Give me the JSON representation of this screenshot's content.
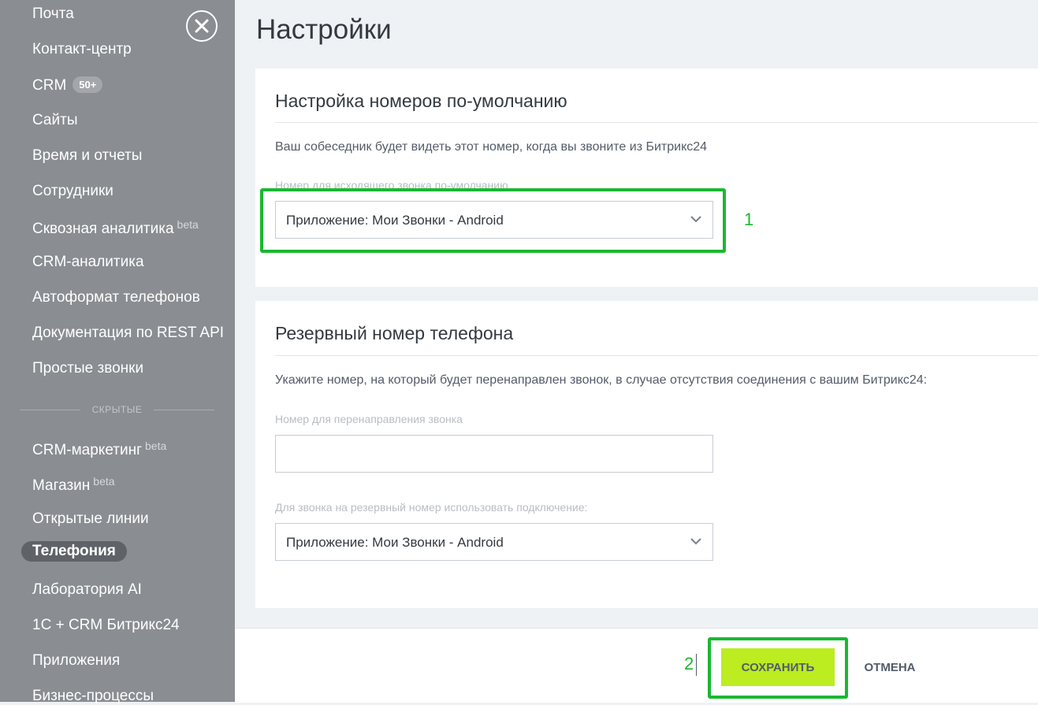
{
  "sidebar": {
    "items": [
      {
        "label": "Почта"
      },
      {
        "label": "Контакт-центр"
      },
      {
        "label": "CRM",
        "badge": "50+"
      },
      {
        "label": "Сайты"
      },
      {
        "label": "Время и отчеты"
      },
      {
        "label": "Сотрудники"
      },
      {
        "label": "Сквозная аналитика",
        "sup": "beta"
      },
      {
        "label": "CRM-аналитика"
      },
      {
        "label": "Автоформат телефонов"
      },
      {
        "label": "Документация по REST API"
      },
      {
        "label": "Простые звонки"
      }
    ],
    "hidden_label": "СКРЫТЫЕ",
    "hidden_items": [
      {
        "label": "CRM-маркетинг",
        "sup": "beta"
      },
      {
        "label": "Магазин",
        "sup": "beta"
      },
      {
        "label": "Открытые линии"
      },
      {
        "label": "Телефония",
        "active": true
      },
      {
        "label": "Лаборатория AI"
      },
      {
        "label": "1С + CRM Битрикс24"
      },
      {
        "label": "Приложения"
      },
      {
        "label": "Бизнес-процессы"
      }
    ]
  },
  "page": {
    "title": "Настройки"
  },
  "default_numbers": {
    "title": "Настройка номеров по-умолчанию",
    "description": "Ваш собеседник будет видеть этот номер, когда вы звоните из Битрикс24",
    "outgoing_label": "Номер для исходящего звонка по-умолчанию",
    "outgoing_value": "Приложение: Мои Звонки - Android"
  },
  "backup_number": {
    "title": "Резервный номер телефона",
    "description": "Укажите номер, на который будет перенаправлен звонок, в случае отсутствия соединения с вашим Битрикс24:",
    "redirect_label": "Номер для перенаправления звонка",
    "redirect_value": "",
    "connection_label": "Для звонка на резервный номер использовать подключение:",
    "connection_value": "Приложение: Мои Звонки - Android"
  },
  "footer": {
    "save_label": "СОХРАНИТЬ",
    "cancel_label": "ОТМЕНА"
  },
  "annotations": {
    "one": "1",
    "two": "2"
  },
  "colors": {
    "accent_green": "#bbed21",
    "highlight": "#1ab831",
    "sidebar_bg": "#8a8d91"
  }
}
